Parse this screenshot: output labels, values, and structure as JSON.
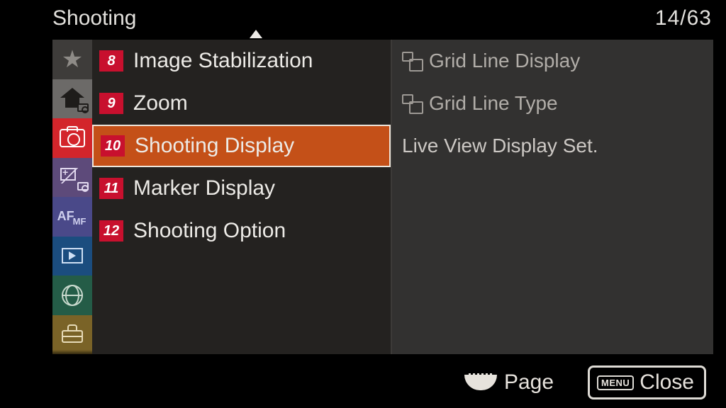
{
  "header": {
    "title": "Shooting",
    "page_counter": "14/63"
  },
  "sidebar_tabs": [
    {
      "id": "favorites",
      "kind": "star"
    },
    {
      "id": "main",
      "kind": "home"
    },
    {
      "id": "shooting",
      "kind": "camera",
      "active": true
    },
    {
      "id": "exposure",
      "kind": "exp"
    },
    {
      "id": "focus",
      "kind": "focus"
    },
    {
      "id": "playback",
      "kind": "play"
    },
    {
      "id": "network",
      "kind": "net"
    },
    {
      "id": "setup",
      "kind": "setup"
    }
  ],
  "menu": {
    "items": [
      {
        "num": "8",
        "label": "Image Stabilization"
      },
      {
        "num": "9",
        "label": "Zoom"
      },
      {
        "num": "10",
        "label": "Shooting Display",
        "selected": true
      },
      {
        "num": "11",
        "label": "Marker Display"
      },
      {
        "num": "12",
        "label": "Shooting Option"
      }
    ]
  },
  "submenu": {
    "items": [
      {
        "label": "Grid Line Display",
        "has_icon": true
      },
      {
        "label": "Grid Line Type",
        "has_icon": true
      },
      {
        "label": "Live View Display Set.",
        "has_icon": false
      }
    ]
  },
  "footer": {
    "page_label": "Page",
    "close_badge": "MENU",
    "close_label": "Close"
  }
}
